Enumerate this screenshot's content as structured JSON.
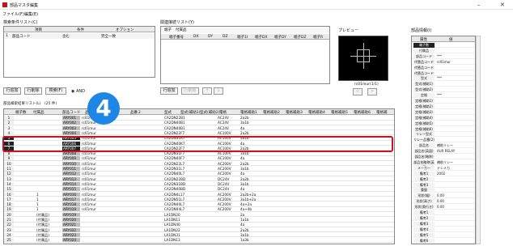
{
  "window": {
    "title": "部品マスタ編集",
    "min": "–",
    "close": "✕"
  },
  "menu": [
    "ファイル(F)",
    "編集(E)"
  ],
  "search": {
    "label": "検索条件リスト(C)",
    "cols": [
      "項目",
      "条件",
      "オプション"
    ],
    "row": {
      "item": "部品コード",
      "cond": "含む",
      "option": "完全一致"
    },
    "buttons": {
      "row_add": "行追加",
      "row_del": "行削除",
      "search": "検索(F)",
      "and": "AND",
      "or": "OR"
    }
  },
  "related": {
    "label": "関連接続リスト(Y)",
    "tabs": [
      "端子",
      "付属品"
    ],
    "cols": [
      "端子番号",
      "DX",
      "DY",
      "DZ",
      "端子1I",
      "端子DX",
      "端子DY",
      "端子DZ",
      "端子R"
    ],
    "buttons": {
      "row_add": "行追加",
      "row_del": "行削除",
      "up": "↑",
      "down": "↓"
    }
  },
  "preview": {
    "label": "プレビュー",
    "caption": "rc01mur(1/1)",
    "prev": "<",
    "next": ">"
  },
  "grid": {
    "label": "部品検索結果リスト(L)　(25 件)",
    "cols": [
      "端子数",
      "付属品",
      "部品コード",
      "品番",
      "品番２",
      "型式",
      "型式(補助1)",
      "型式(補助2)",
      "電格",
      "電格補助1",
      "電格補助2",
      "電格補助3",
      "電格補助4",
      "電格補助5",
      "電格補助6",
      "電格補"
    ],
    "rows": [
      {
        "no": "1",
        "sub": "",
        "code": "ARY001",
        "name": "rc01mur",
        "type": "CA2DN22B1",
        "vol": "AC24V",
        "cur": "2a2b"
      },
      {
        "no": "2",
        "sub": "",
        "code": "ARY002",
        "name": "rc01mur",
        "type": "CA2DN40B1",
        "vol": "AC24V",
        "cur": "3a1b"
      },
      {
        "no": "3",
        "sub": "",
        "code": "ARY003",
        "name": "rc01mur",
        "type": "CA2DN40B1",
        "vol": "AC24V",
        "cur": "4a"
      },
      {
        "no": "4",
        "sub": "",
        "code": "ARY004",
        "name": "rc01mur",
        "type": "CA2DN22F7",
        "vol": "AC100V",
        "cur": "2a2b"
      },
      {
        "no": "5",
        "sub": "",
        "code": "ARY005",
        "name": "rc01mur",
        "type": "CA2DN31K7",
        "vol": "AC100V",
        "cur": "3a1b"
      },
      {
        "no": "6",
        "sub": "",
        "code": "ARY006",
        "name": "rc01mur",
        "type": "CA2DN40K7",
        "vol": "AC100V",
        "cur": "4a"
      },
      {
        "no": "7",
        "sub": "",
        "code": "ARY007",
        "name": "rc01mur",
        "type": "CA2DN22F7",
        "vol": "AC100V",
        "cur": "2a2b"
      },
      {
        "no": "8",
        "sub": "",
        "code": "ARY008",
        "name": "rc01mur",
        "type": "CA2DN31F7",
        "vol": "AC100V",
        "cur": "3a1b"
      },
      {
        "no": "9",
        "sub": "",
        "code": "ARY009",
        "name": "rc01mur",
        "type": "CA2DN40F7",
        "vol": "AC100V",
        "cur": "4a"
      },
      {
        "no": "10",
        "sub": "",
        "code": "ARY010",
        "name": "rc01mur",
        "type": "CA2DN22L7",
        "vol": "AC200V",
        "cur": "2a2b"
      },
      {
        "no": "11",
        "sub": "",
        "code": "ARY011",
        "name": "rc01mur",
        "type": "CA2DN31L7",
        "vol": "AC200V",
        "cur": "3a1b"
      },
      {
        "no": "12",
        "sub": "",
        "code": "ARY012",
        "name": "rc01mur",
        "type": "CA2DN40L7",
        "vol": "AC200V",
        "cur": "4a"
      },
      {
        "no": "13",
        "sub": "",
        "code": "ARY013",
        "name": "rc01mur",
        "type": "CA2DN22BD",
        "vol": "DC24V",
        "cur": "2a2b"
      },
      {
        "no": "14",
        "sub": "",
        "code": "ARY014",
        "name": "rc01mur",
        "type": "CA2DN31BD",
        "vol": "DC24V",
        "cur": "3a1b"
      },
      {
        "no": "15",
        "sub": "",
        "code": "ARY015",
        "name": "rc01mur",
        "type": "CA2DN40BD",
        "vol": "DC24V",
        "cur": "4a"
      },
      {
        "no": "16",
        "sub": "1",
        "code": "ARY016",
        "name": "rc01mur",
        "type": "CA2DN4L17",
        "vol": "AC200V",
        "cur": "2a2b+2a"
      },
      {
        "no": "17",
        "sub": "1",
        "code": "ARY017",
        "name": "rc01mur",
        "type": "CA2DN51L7",
        "vol": "AC200V",
        "cur": "3a1b+2a"
      },
      {
        "no": "18",
        "sub": "1",
        "code": "ARY018",
        "name": "rc01mur",
        "type": "CA2DN40L7",
        "vol": "AC200V",
        "cur": "4a+2a"
      },
      {
        "no": "19",
        "sub": "1",
        "code": "ARY019",
        "name": "rc01mur",
        "type": "CA2DN44L7",
        "vol": "AC200V",
        "cur": "4a+4b"
      },
      {
        "no": "20",
        "sub": "(付属品)",
        "code": "ARY019",
        "name": "",
        "type": "LA1DN20",
        "vol": "",
        "cur": "2a"
      },
      {
        "no": "21",
        "sub": "(付属品)",
        "code": "ARY020",
        "name": "",
        "type": "LA1DN11",
        "vol": "",
        "cur": "1a1b"
      },
      {
        "no": "22",
        "sub": "(付属品)",
        "code": "ARY021",
        "name": "",
        "type": "LA1DN40",
        "vol": "",
        "cur": "4a"
      },
      {
        "no": "23",
        "sub": "(付属品)",
        "code": "ARY022",
        "name": "",
        "type": "LA1DN22",
        "vol": "",
        "cur": "2a2b"
      },
      {
        "no": "24",
        "sub": "(付属品)",
        "code": "ARY023",
        "name": "",
        "type": "LA1DN31",
        "vol": "",
        "cur": "3a1b"
      },
      {
        "no": "25",
        "sub": "(付属品)",
        "code": "ARY024",
        "name": "",
        "type": "LA1DN13",
        "vol": "",
        "cur": "1a3b"
      }
    ]
  },
  "badge": "4",
  "props": {
    "label": "部品情報(I)",
    "cols": [
      "属性",
      "値"
    ],
    "rows": [
      {
        "k": "端子数",
        "v": ""
      },
      {
        "k": "付属品",
        "v": ""
      },
      {
        "k": "部品コード",
        "v": "***"
      },
      {
        "k": "代替品コード",
        "v": "rc01mur"
      },
      {
        "k": "代替品コード",
        "v": ""
      },
      {
        "k": "代替品コード",
        "v": ""
      },
      {
        "k": "型式",
        "v": "***"
      },
      {
        "k": "型式(補助1)",
        "v": ""
      },
      {
        "k": "型式(補助2)",
        "v": ""
      },
      {
        "k": "定格",
        "v": "***"
      },
      {
        "k": "定格(補助1)",
        "v": ""
      },
      {
        "k": "定格(補助2)",
        "v": ""
      },
      {
        "k": "定格(補助3)",
        "v": ""
      },
      {
        "k": "定格(補助4)",
        "v": ""
      },
      {
        "k": "定格(補助5)",
        "v": ""
      },
      {
        "k": "定格(補助6)",
        "v": ""
      },
      {
        "k": "リレー型式",
        "v": ""
      },
      {
        "k": "リレー品番(2)",
        "v": ""
      },
      {
        "k": "部品名",
        "v": "補助リレー"
      },
      {
        "k": "部品名(英語)",
        "v": "AUX RELAY"
      },
      {
        "k": "部品名(略称)",
        "v": ""
      },
      {
        "k": "部品名略称(英語)",
        "v": "補助リレー"
      },
      {
        "k": "メーカー",
        "v": "テレメカ"
      },
      {
        "k": "備考1",
        "v": "2002"
      },
      {
        "k": "備考2",
        "v": ""
      },
      {
        "k": "備考3",
        "v": ""
      },
      {
        "k": "重量",
        "v": ""
      },
      {
        "k": "形状(幅)",
        "v": "0.00"
      },
      {
        "k": "形状(高さ)",
        "v": "0.00"
      },
      {
        "k": "形状(奥行き)",
        "v": "0.00"
      },
      {
        "k": "備考1",
        "v": ""
      },
      {
        "k": "備考2",
        "v": ""
      },
      {
        "k": "備考3",
        "v": ""
      },
      {
        "k": "備考4",
        "v": ""
      },
      {
        "k": "備考5",
        "v": ""
      },
      {
        "k": "備考6",
        "v": ""
      }
    ]
  }
}
